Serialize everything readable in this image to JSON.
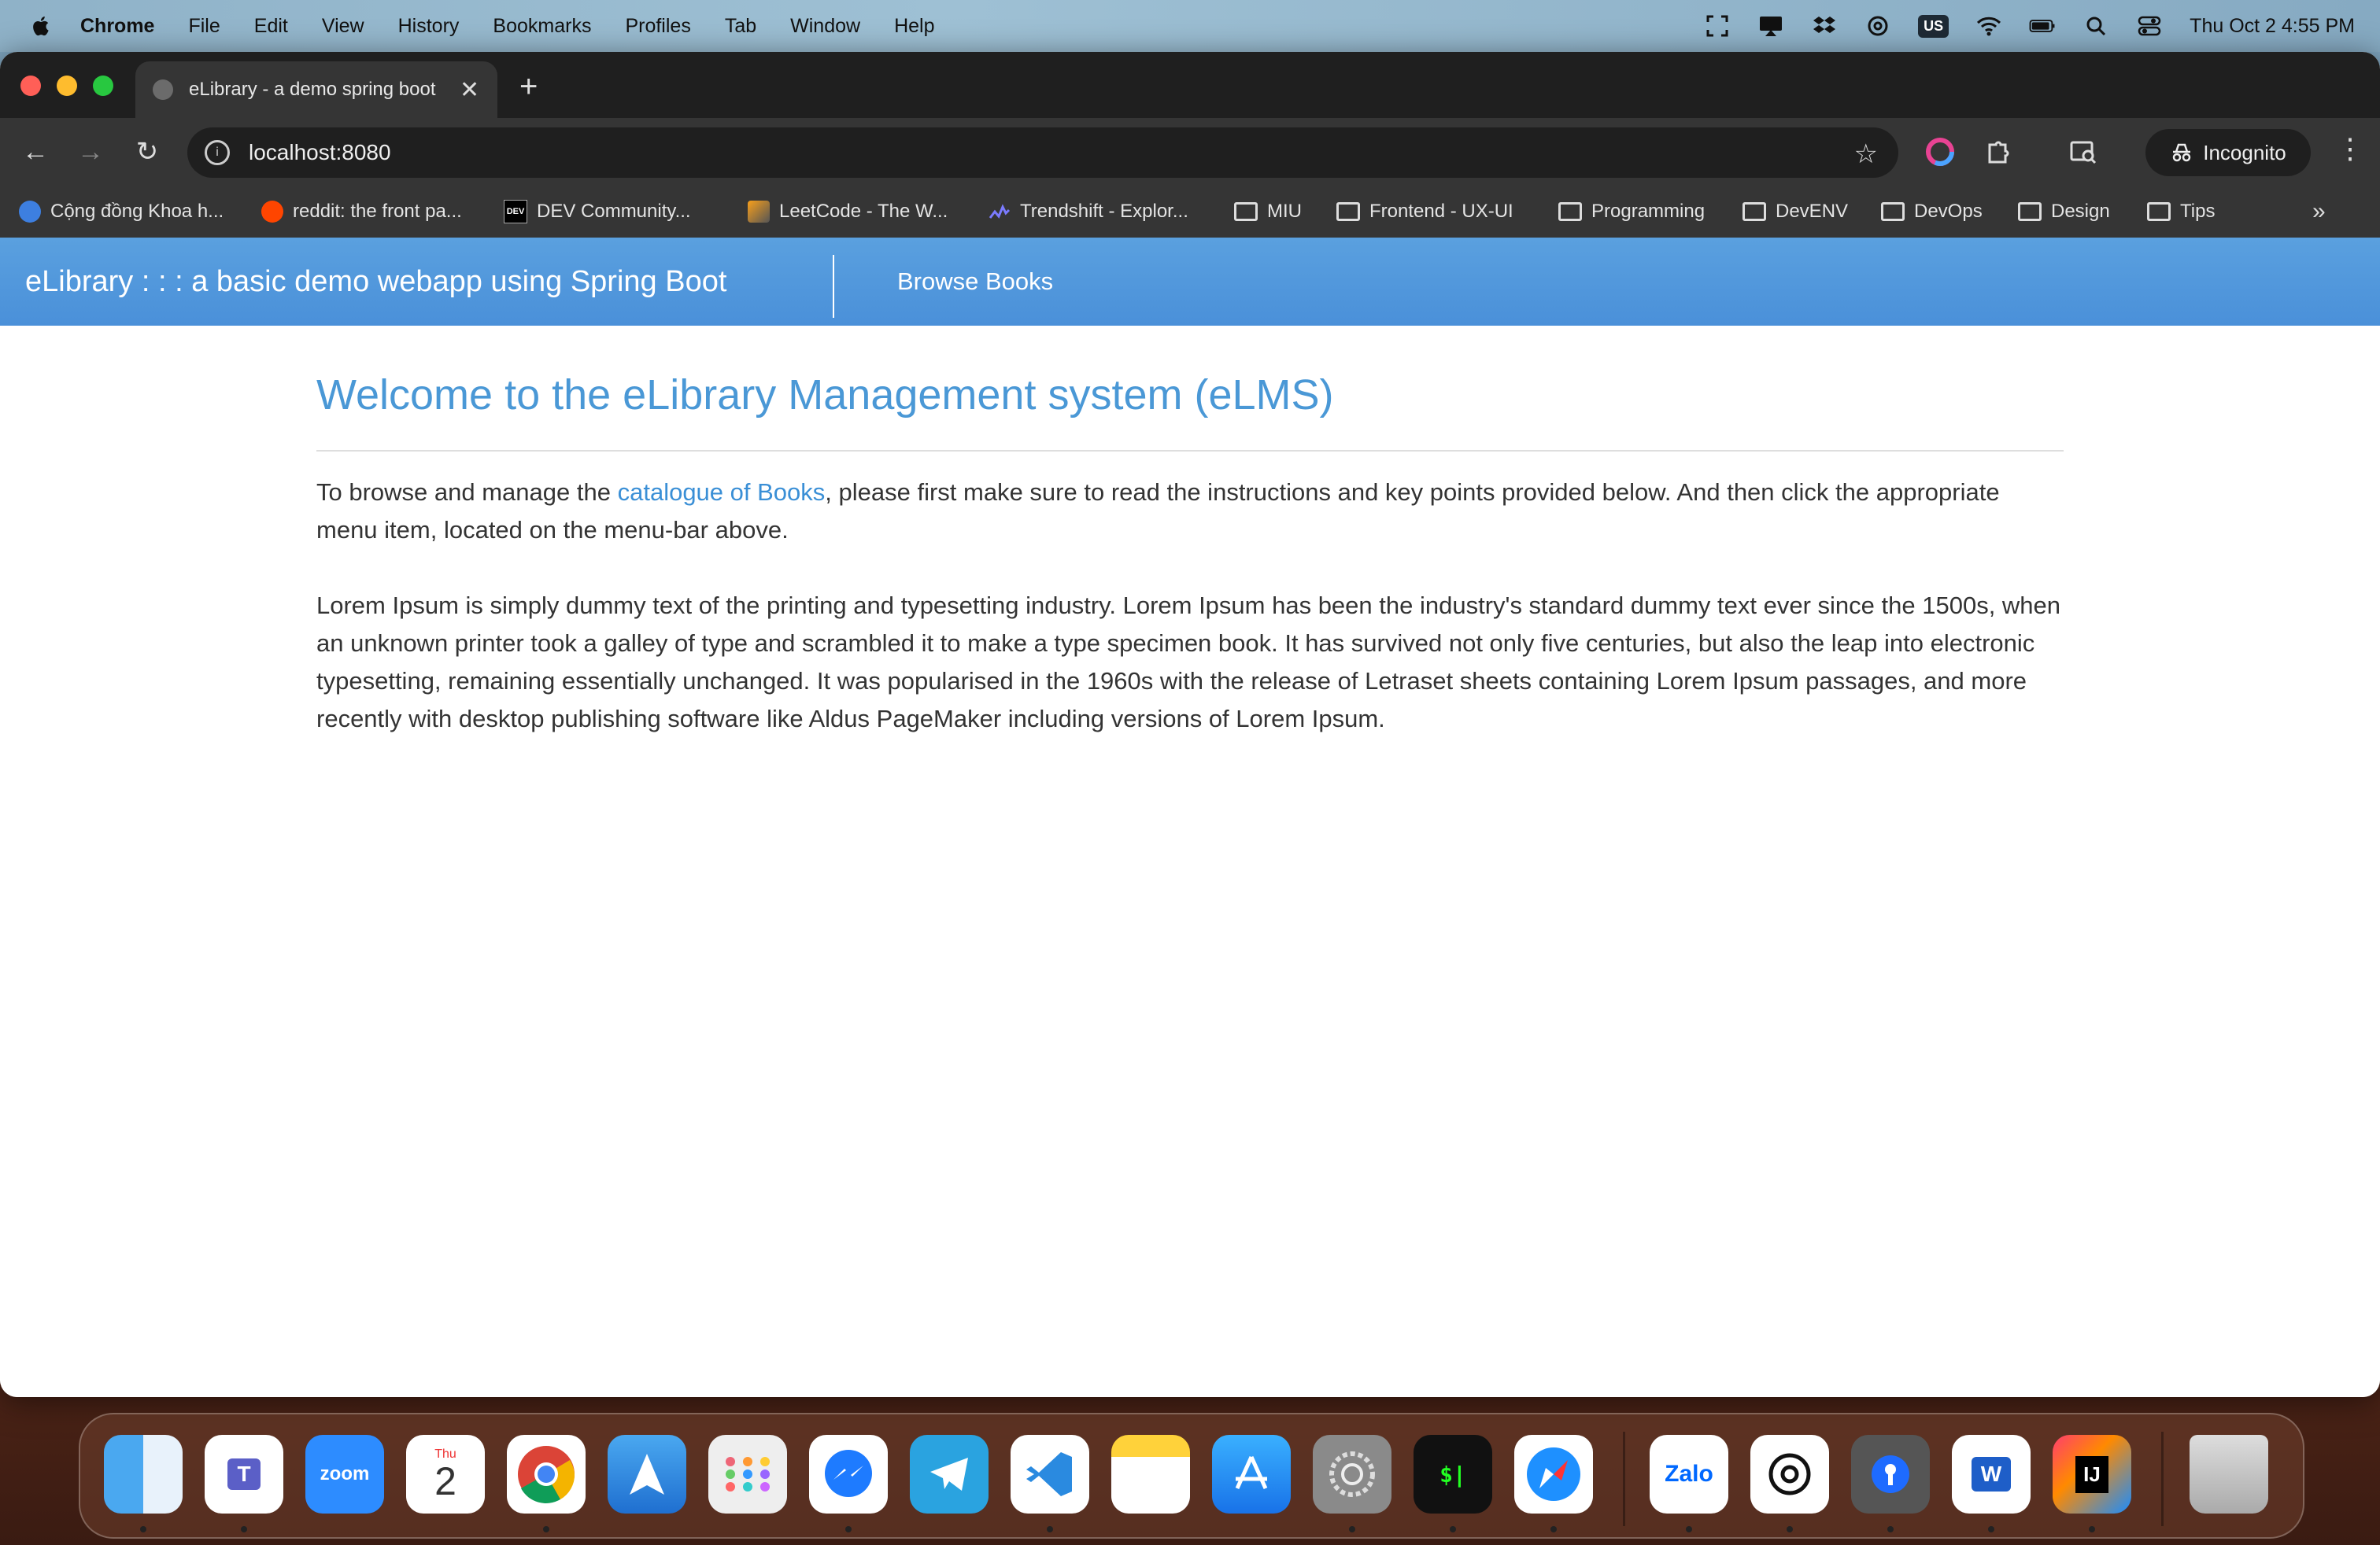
{
  "menubar": {
    "app": "Chrome",
    "items": [
      "File",
      "Edit",
      "View",
      "History",
      "Bookmarks",
      "Profiles",
      "Tab",
      "Window",
      "Help"
    ],
    "keyboard": "US",
    "clock": "Thu Oct 2  4:55 PM",
    "status_icons": [
      "screenshot-icon",
      "display-icon",
      "dropbox-icon",
      "openai-icon",
      "keyboard-layout-icon",
      "wifi-icon",
      "battery-icon",
      "search-icon",
      "control-center-icon"
    ]
  },
  "browser": {
    "tab_title": "eLibrary - a demo spring boot",
    "tab_close": "✕",
    "new_tab": "+",
    "url": "localhost:8080",
    "profile": "Incognito",
    "bookmarks": [
      {
        "label": "Cộng đồng Khoa h...",
        "icon": "site-icon"
      },
      {
        "label": "reddit: the front pa...",
        "icon": "reddit-icon"
      },
      {
        "label": "DEV Community...",
        "icon": "dev-icon"
      },
      {
        "label": "LeetCode - The W...",
        "icon": "leetcode-icon"
      },
      {
        "label": "Trendshift - Explor...",
        "icon": "trendshift-icon"
      },
      {
        "label": "MIU",
        "icon": "folder-icon"
      },
      {
        "label": "Frontend - UX-UI",
        "icon": "folder-icon"
      },
      {
        "label": "Programming",
        "icon": "folder-icon"
      },
      {
        "label": "DevENV",
        "icon": "folder-icon"
      },
      {
        "label": "DevOps",
        "icon": "folder-icon"
      },
      {
        "label": "Design",
        "icon": "folder-icon"
      },
      {
        "label": "Tips",
        "icon": "folder-icon"
      }
    ]
  },
  "app": {
    "brand": "eLibrary : : : a basic demo webapp using Spring Boot",
    "nav_link": "Browse Books",
    "heading": "Welcome to the eLibrary Management system (eLMS)",
    "intro_before": "To browse and manage the ",
    "intro_link": "catalogue of Books",
    "intro_after": ", please first make sure to read the instructions and key points provided below. And then click the appropriate menu item, located on the menu-bar above.",
    "lorem": "Lorem Ipsum is simply dummy text of the printing and typesetting industry. Lorem Ipsum has been the industry's standard dummy text ever since the 1500s, when an unknown printer took a galley of type and scrambled it to make a type specimen book. It has survived not only five centuries, but also the leap into electronic typesetting, remaining essentially unchanged. It was popularised in the 1960s with the release of Letraset sheets containing Lorem Ipsum passages, and more recently with desktop publishing software like Aldus PageMaker including versions of Lorem Ipsum."
  },
  "dock": {
    "calendar_month": "Thu",
    "calendar_day": "2",
    "zoom_label": "zoom",
    "zalo_label": "Zalo",
    "colors": {
      "accent": "#4a90d9",
      "link": "#3a8fd6",
      "heading": "#4a98d6"
    }
  }
}
